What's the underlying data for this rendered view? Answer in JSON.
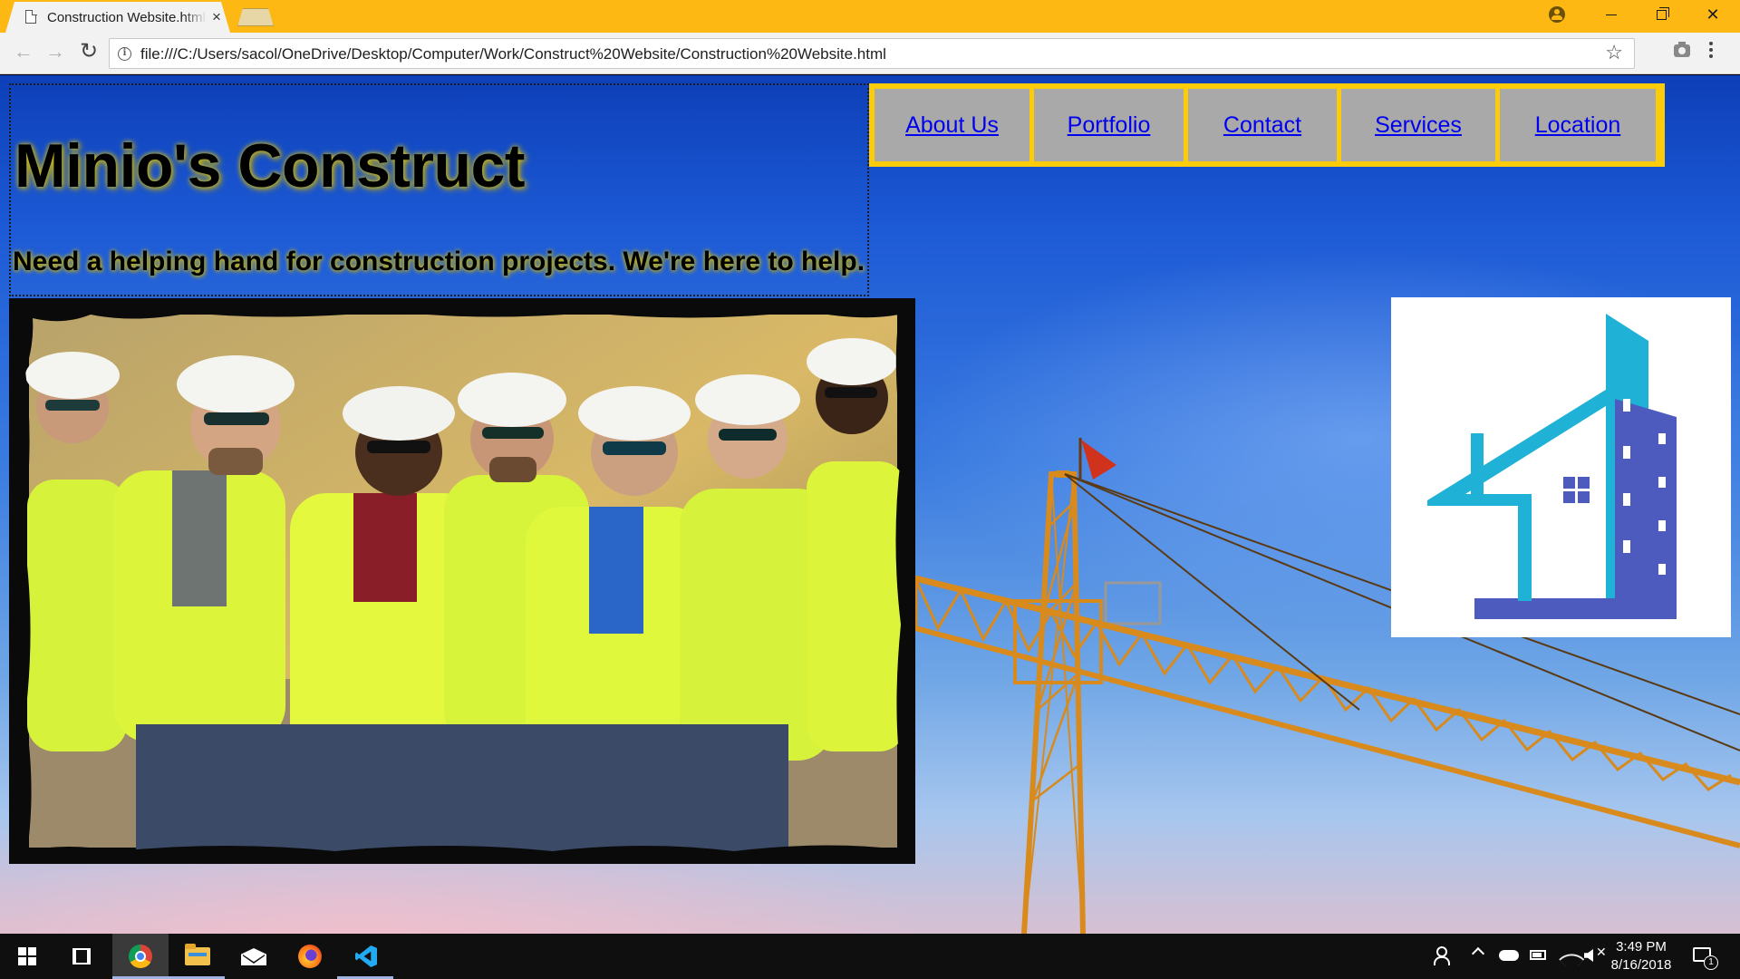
{
  "browser": {
    "tab_title": "Construction Website.html",
    "tab_close": "×",
    "url": "file:///C:/Users/sacol/OneDrive/Desktop/Computer/Work/Construct%20Website/Construction%20Website.html",
    "back_glyph": "←",
    "forward_glyph": "→",
    "reload_glyph": "↻",
    "star_glyph": "☆",
    "close_glyph": "✕"
  },
  "page": {
    "title": "Minio's Construct",
    "tagline": "Need a helping hand for construction projects. We're here to help.",
    "nav": [
      "About Us",
      "Portfolio",
      "Contact",
      "Services",
      "Location"
    ]
  },
  "colors": {
    "titlebar": "#fdb813",
    "nav_border": "#fccc0a",
    "nav_item_bg": "#a9a9a9",
    "link": "#0000ee",
    "logo_teal": "#1fb2d6",
    "logo_indigo": "#4d5bbf"
  },
  "taskbar": {
    "time": "3:49 PM",
    "date": "8/16/2018",
    "notification_count": "1",
    "mute_glyph": "✕"
  }
}
